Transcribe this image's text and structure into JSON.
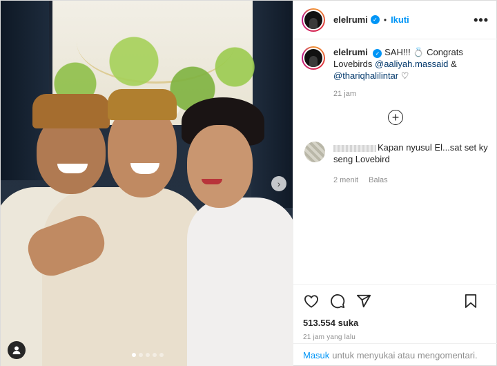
{
  "post": {
    "username": "elelrumi",
    "follow_label": "Ikuti",
    "separator": "•",
    "more_glyph": "•••",
    "caption": {
      "prefix": "SAH!!! 💍 Congrats Lovebirds",
      "mention1": "@aaliyah.massaid",
      "joiner": "&",
      "mention2": "@thariqhalilintar",
      "suffix": "♡",
      "time": "21 jam"
    },
    "load_more_glyph": "+",
    "comment": {
      "text": "Kapan nyusul El...sat set ky seng Lovebird",
      "time": "2 menit",
      "reply_label": "Balas"
    },
    "likes": "513.554 suka",
    "posted_time": "21 jam yang lalu",
    "login": {
      "link": "Masuk",
      "text": "untuk menyukai atau mengomentari."
    },
    "carousel": {
      "slide_count": 5,
      "active_index": 0,
      "next_glyph": "›"
    }
  },
  "colors": {
    "link_blue": "#0095f6",
    "mention_navy": "#00376b",
    "muted_gray": "#8e8e8e",
    "text": "#262626"
  },
  "icons": [
    "verified-badge-icon",
    "more-options-icon",
    "load-more-icon",
    "heart-icon",
    "comment-icon",
    "share-icon",
    "bookmark-icon",
    "next-arrow-icon",
    "user-profile-icon"
  ]
}
